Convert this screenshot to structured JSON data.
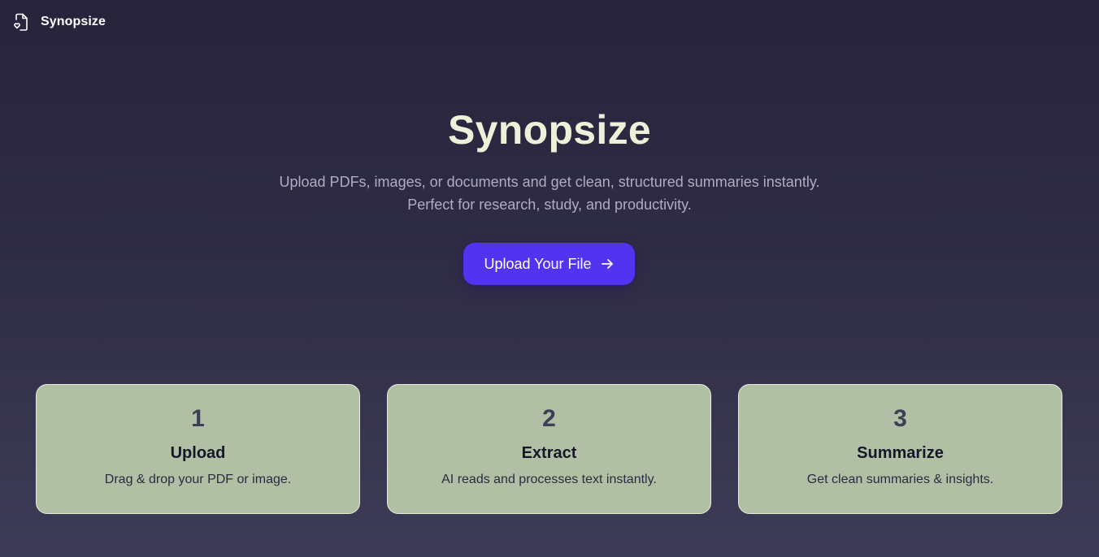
{
  "header": {
    "brand": "Synopsize",
    "logo_icon": "file-heart-icon"
  },
  "hero": {
    "title": "Synopsize",
    "subtitle_line1": "Upload PDFs, images, or documents and get clean, structured summaries instantly.",
    "subtitle_line2": "Perfect for research, study, and productivity.",
    "cta_label": "Upload Your File",
    "cta_icon": "arrow-right-icon"
  },
  "steps": [
    {
      "number": "1",
      "title": "Upload",
      "description": "Drag & drop your PDF or image."
    },
    {
      "number": "2",
      "title": "Extract",
      "description": "AI reads and processes text instantly."
    },
    {
      "number": "3",
      "title": "Summarize",
      "description": "Get clean summaries & insights."
    }
  ],
  "colors": {
    "background_top": "#26233a",
    "background_bottom": "#3e3b56",
    "accent": "#5133f0",
    "card": "#b1c0a4",
    "title": "#eef0da"
  }
}
